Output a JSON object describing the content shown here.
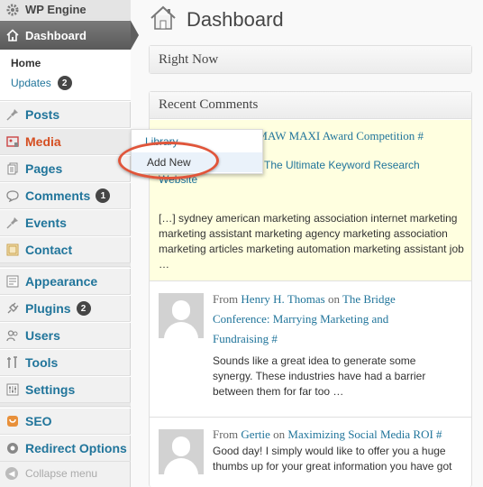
{
  "sidebar": {
    "site_name": "WP Engine",
    "dashboard": "Dashboard",
    "submenu": {
      "home": "Home",
      "updates": "Updates",
      "updates_count": "2"
    },
    "items": [
      {
        "label": "Posts",
        "icon": "pin-icon"
      },
      {
        "label": "Media",
        "icon": "media-icon"
      },
      {
        "label": "Pages",
        "icon": "pages-icon"
      },
      {
        "label": "Comments",
        "icon": "comment-icon",
        "count": "1"
      },
      {
        "label": "Events",
        "icon": "pin-icon"
      },
      {
        "label": "Contact",
        "icon": "contact-icon"
      },
      {
        "label": "Appearance",
        "icon": "appearance-icon"
      },
      {
        "label": "Plugins",
        "icon": "plugin-icon",
        "count": "2"
      },
      {
        "label": "Users",
        "icon": "users-icon"
      },
      {
        "label": "Tools",
        "icon": "tools-icon"
      },
      {
        "label": "Settings",
        "icon": "settings-icon"
      },
      {
        "label": "SEO",
        "icon": "seo-icon"
      },
      {
        "label": "Redirect Options",
        "icon": "redirect-icon"
      }
    ],
    "collapse": "Collapse menu"
  },
  "flyout": {
    "library": "Library",
    "add_new": "Add New"
  },
  "page": {
    "title": "Dashboard"
  },
  "right_now": {
    "title": "Right Now"
  },
  "recent_comments": {
    "title": "Recent Comments",
    "comments": [
      {
        "line1": "DMAW MAXI Award Competition #",
        "line2": "The Ultimate Keyword Research",
        "line3": "Website",
        "body": "[…] sydney american marketing association internet marketing marketing assistant marketing agency marketing association marketing articles marketing automation marketing assistant job …"
      },
      {
        "from": "From",
        "author": "Henry H. Thomas",
        "on": "on",
        "post_line1": "The Bridge",
        "post_line2": "Conference: Marrying Marketing and",
        "post_line3": "Fundraising #",
        "body": "Sounds like a great idea to generate some synergy. These industries have had a barrier between them for far too …"
      },
      {
        "from": "From",
        "author": "Gertie",
        "on": "on",
        "post": "Maximizing Social Media ROI #",
        "body": "Good day! I simply would like to offer you a huge thumbs up for your great information you have got"
      }
    ]
  },
  "colors": {
    "link": "#21759b",
    "active": "#d54e21",
    "highlight_ring": "#e0553a",
    "pending_bg": "#ffffe0"
  }
}
